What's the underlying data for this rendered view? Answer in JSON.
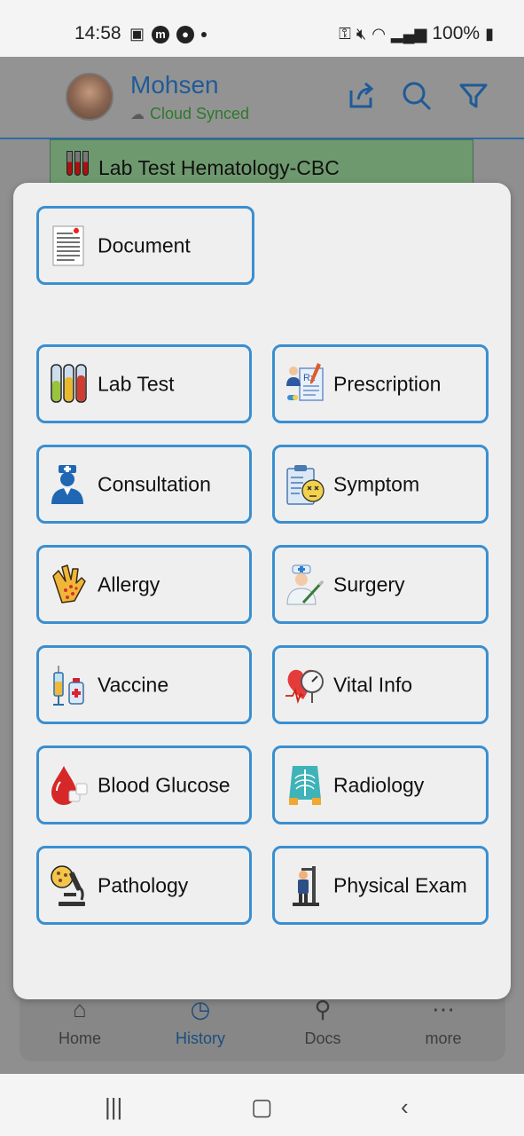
{
  "status_bar": {
    "time": "14:58",
    "battery": "100%"
  },
  "header": {
    "user_name": "Mohsen",
    "sync_status": "Cloud Synced",
    "icons": [
      "share-icon",
      "search-icon",
      "filter-icon"
    ]
  },
  "background_card": {
    "label": "Lab Test Hematology-CBC"
  },
  "modal": {
    "document": "Document",
    "tiles": [
      {
        "label": "Lab Test",
        "icon": "test-tubes-icon"
      },
      {
        "label": "Prescription",
        "icon": "prescription-icon"
      },
      {
        "label": "Consultation",
        "icon": "doctor-icon"
      },
      {
        "label": "Symptom",
        "icon": "symptom-clipboard-icon"
      },
      {
        "label": "Allergy",
        "icon": "allergy-hand-icon"
      },
      {
        "label": "Surgery",
        "icon": "surgeon-icon"
      },
      {
        "label": "Vaccine",
        "icon": "vaccine-icon"
      },
      {
        "label": "Vital Info",
        "icon": "heart-gauge-icon"
      },
      {
        "label": "Blood Glucose",
        "icon": "blood-drop-icon"
      },
      {
        "label": "Radiology",
        "icon": "xray-icon"
      },
      {
        "label": "Pathology",
        "icon": "microscope-icon"
      },
      {
        "label": "Physical Exam",
        "icon": "height-scale-icon"
      }
    ]
  },
  "bottom_nav": {
    "items": [
      {
        "label": "Home"
      },
      {
        "label": "History"
      },
      {
        "label": "Docs"
      },
      {
        "label": "more"
      }
    ]
  },
  "colors": {
    "accent": "#3a8fd1",
    "brand_blue": "#1f5b97",
    "sync_green": "#2c7a2c"
  }
}
